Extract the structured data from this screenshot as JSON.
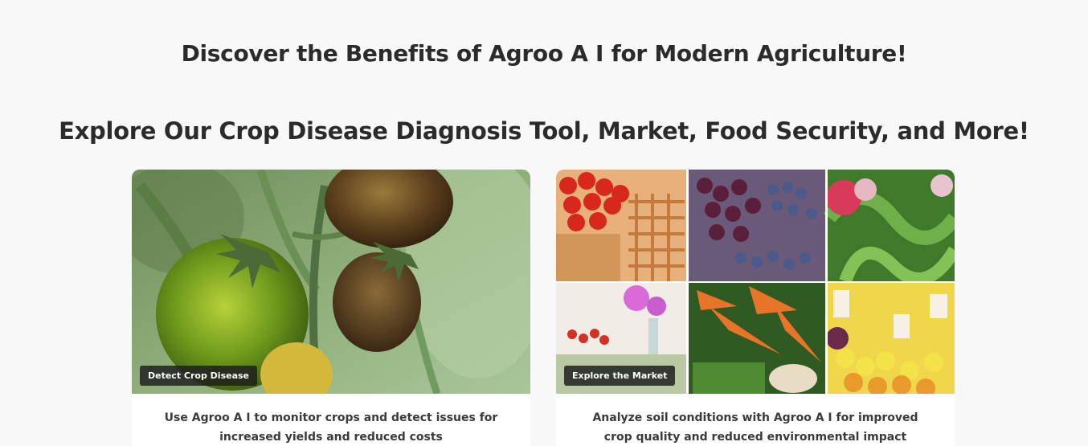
{
  "hero": {
    "title": "Discover the Benefits of Agroo A I for Modern Agriculture!"
  },
  "section": {
    "title": "Explore Our Crop Disease Diagnosis Tool, Market, Food Security, and More!"
  },
  "cards": [
    {
      "badge": "Detect Crop Disease",
      "description": "Use Agroo A I to monitor crops and detect issues for increased yields and reduced costs",
      "image": "diseased-tomatoes-photo"
    },
    {
      "badge": "Explore the Market",
      "description": "Analyze soil conditions with Agroo A I for improved crop quality and reduced environmental impact",
      "image": "market-produce-collage"
    }
  ],
  "colors": {
    "background": "#f8f8f8",
    "badge_bg": "#1e1e1e",
    "text": "#2b2b2b"
  }
}
